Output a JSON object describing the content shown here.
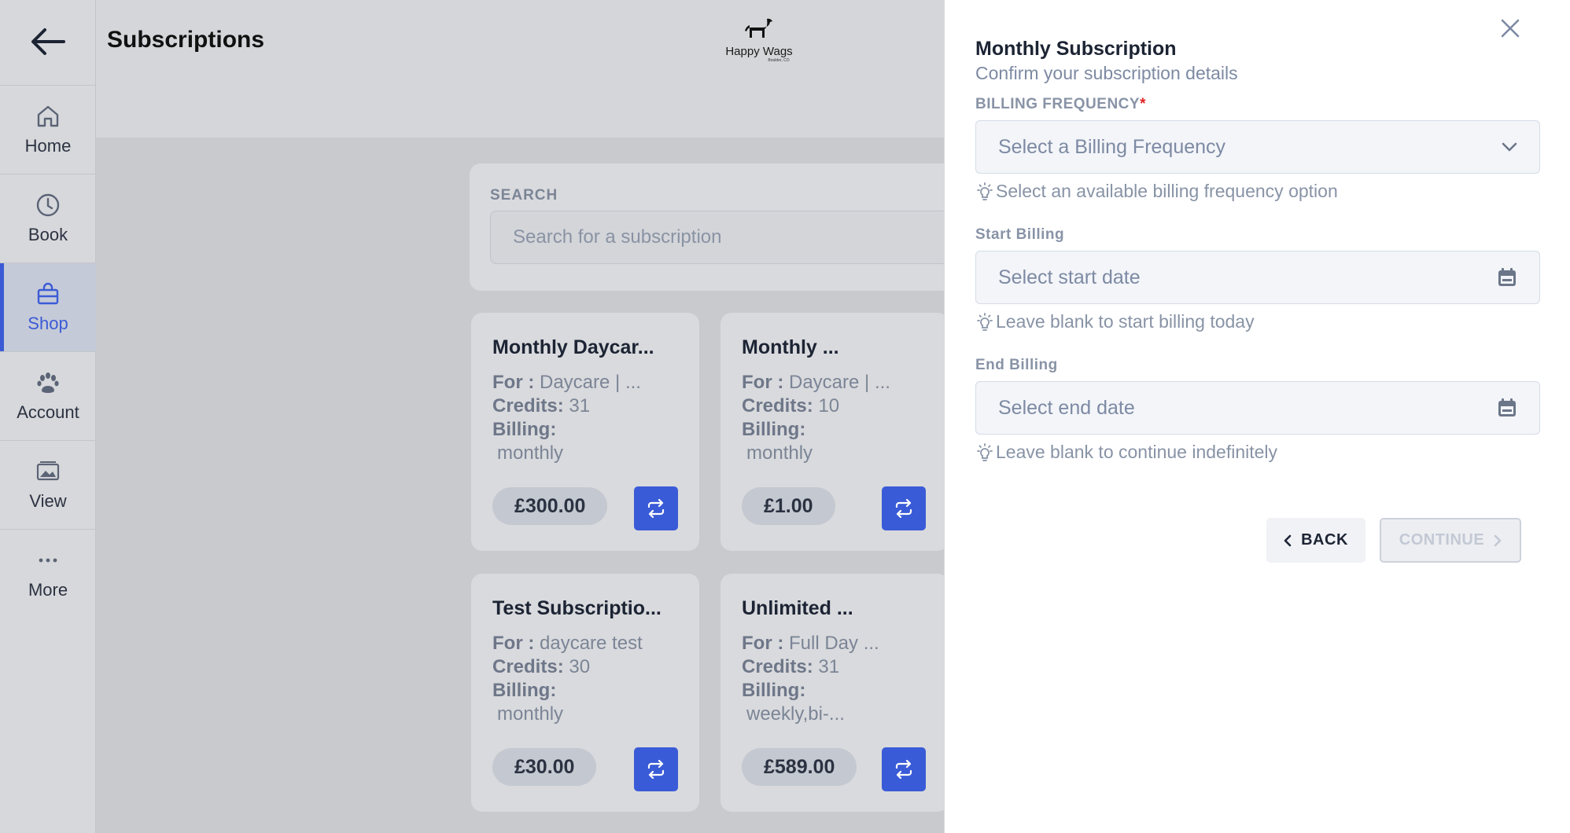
{
  "header": {
    "title": "Subscriptions",
    "logo_text": "Happy Wags",
    "logo_subtext": "Boulder, CO"
  },
  "sidebar": {
    "items": [
      {
        "label": "Home",
        "icon": "home-icon"
      },
      {
        "label": "Book",
        "icon": "clock-icon"
      },
      {
        "label": "Shop",
        "icon": "shopping-bag-icon",
        "active": true
      },
      {
        "label": "Account",
        "icon": "paw-icon"
      },
      {
        "label": "View",
        "icon": "gallery-icon"
      },
      {
        "label": "More",
        "icon": "more-dots-icon"
      }
    ]
  },
  "search": {
    "label": "SEARCH",
    "placeholder": "Search for a subscription"
  },
  "subscriptions": [
    {
      "title": "Monthly Daycar...",
      "for_label": "For :",
      "for_value": "Daycare | ...",
      "credits_label": "Credits:",
      "credits_value": "31",
      "billing_label": "Billing:",
      "billing_value": "monthly",
      "price": "£300.00"
    },
    {
      "title": "Monthly ...",
      "for_label": "For :",
      "for_value": "Daycare | ...",
      "credits_label": "Credits:",
      "credits_value": "10",
      "billing_label": "Billing:",
      "billing_value": "monthly",
      "price": "£1.00"
    },
    {
      "title": "Test Subscriptio...",
      "for_label": "For :",
      "for_value": "daycare test",
      "credits_label": "Credits:",
      "credits_value": "30",
      "billing_label": "Billing:",
      "billing_value": "monthly",
      "price": "£30.00"
    },
    {
      "title": "Unlimited ...",
      "for_label": "For :",
      "for_value": "Full Day ...",
      "credits_label": "Credits:",
      "credits_value": "31",
      "billing_label": "Billing:",
      "billing_value": "weekly,bi-...",
      "price": "£589.00"
    }
  ],
  "panel": {
    "title": "Monthly Subscription",
    "subtitle": "Confirm your subscription details",
    "billing_frequency": {
      "label": "BILLING FREQUENCY",
      "required_mark": "*",
      "placeholder": "Select a Billing Frequency",
      "hint": "Select an available billing frequency option"
    },
    "start_billing": {
      "label": "Start Billing",
      "placeholder": "Select start date",
      "hint": "Leave blank to start billing today"
    },
    "end_billing": {
      "label": "End Billing",
      "placeholder": "Select end date",
      "hint": "Leave blank to continue indefinitely"
    },
    "back_label": "BACK",
    "continue_label": "CONTINUE"
  },
  "colors": {
    "accent": "#3a5bd7",
    "required": "#e02424",
    "overlay_bg": "#d5d6d9",
    "panel_bg": "#ffffff"
  }
}
